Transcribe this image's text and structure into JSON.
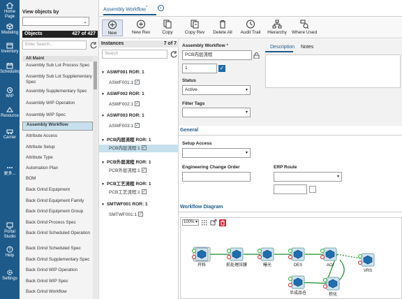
{
  "nav": {
    "items": [
      {
        "label": "Home Page",
        "icon": "home-icon"
      },
      {
        "label": "Modeling",
        "icon": "cube-icon"
      },
      {
        "label": "Inventory",
        "icon": "box-icon"
      },
      {
        "label": "Scheduling",
        "icon": "calendar-icon"
      },
      {
        "label": "WIP",
        "icon": "wip-icon"
      },
      {
        "label": "Resource",
        "icon": "resource-icon"
      },
      {
        "label": "Carrier",
        "icon": "carrier-icon"
      },
      {
        "label": "更多...",
        "icon": "more-icon"
      },
      {
        "label": "Portal Studio",
        "icon": "portal-icon"
      },
      {
        "label": "Help",
        "icon": "help-icon"
      },
      {
        "label": "Settings",
        "icon": "settings-icon"
      }
    ]
  },
  "objects": {
    "view_label": "View objects by",
    "header_label": "Objects",
    "count": "427 of 427",
    "search_placeholder": "Enter Search...",
    "items": [
      {
        "label": "All Maint",
        "kind": "hdr"
      },
      {
        "label": "Assembly Sub Lot Process Spec",
        "kind": "item"
      },
      {
        "label": "Assembly Sub Lot Supplementary Spec",
        "kind": "item"
      },
      {
        "label": "Assembly Supplementary Spec",
        "kind": "item"
      },
      {
        "label": "Assembly WIP Operation",
        "kind": "item"
      },
      {
        "label": "Assembly WIP Spec",
        "kind": "item"
      },
      {
        "label": "Assembly Workflow",
        "kind": "sel"
      },
      {
        "label": "Attribute Access",
        "kind": "item"
      },
      {
        "label": "Attribute Setup",
        "kind": "item"
      },
      {
        "label": "Attribute Type",
        "kind": "item"
      },
      {
        "label": "Automation Plan",
        "kind": "item"
      },
      {
        "label": "BOM",
        "kind": "item"
      },
      {
        "label": "Back Grind Equipment",
        "kind": "item"
      },
      {
        "label": "Back Grind Equipment Family",
        "kind": "item"
      },
      {
        "label": "Back Grind Equipment Group",
        "kind": "item"
      },
      {
        "label": "Back Grind Process Spec",
        "kind": "item"
      },
      {
        "label": "Back Grind Scheduled Operation",
        "kind": "item"
      },
      {
        "label": "Back Grind Scheduled Spec",
        "kind": "item"
      },
      {
        "label": "Back Grind Supplementary Spec",
        "kind": "item"
      },
      {
        "label": "Back Grind WIP Operation",
        "kind": "item"
      },
      {
        "label": "Back Grind WIP Spec",
        "kind": "item"
      },
      {
        "label": "Back Grind Workflow",
        "kind": "item"
      }
    ]
  },
  "tab": {
    "label": "Assembly Workflow",
    "marker": "*"
  },
  "toolbar": {
    "buttons": [
      {
        "label": "New",
        "icon": "plus-circle-icon"
      },
      {
        "label": "New Rev",
        "icon": "plus-circle-icon"
      },
      {
        "label": "Copy",
        "icon": "copy-icon"
      },
      {
        "label": "Copy Rev",
        "icon": "copy-rev-icon"
      },
      {
        "label": "Delete All",
        "icon": "trash-icon"
      },
      {
        "label": "Audit Trail",
        "icon": "clock-icon"
      },
      {
        "label": "Hierarchy",
        "icon": "hierarchy-icon"
      },
      {
        "label": "Where Used",
        "icon": "where-used-icon"
      }
    ]
  },
  "instances": {
    "header_label": "Instances",
    "count": "7 of 7",
    "search_placeholder": "Search",
    "groups": [
      {
        "name": "ASWF001 ROR: 1",
        "revs": [
          {
            "label": "ASWF001:1",
            "sel": false
          }
        ]
      },
      {
        "name": "ASWF002 ROR: 1",
        "revs": [
          {
            "label": "ASWF002:1",
            "sel": false
          }
        ]
      },
      {
        "name": "ASWF003 ROR: 1",
        "revs": [
          {
            "label": "ASWF003:1",
            "sel": false
          }
        ]
      },
      {
        "name": "PCB内层流程 ROR: 1",
        "revs": [
          {
            "label": "PCB内层流程:1",
            "sel": true
          }
        ]
      },
      {
        "name": "PCB外层流程 ROR: 1",
        "revs": [
          {
            "label": "PCB外层流程:1",
            "sel": false
          }
        ]
      },
      {
        "name": "PCB工艺流程 ROR: 1",
        "revs": [
          {
            "label": "PCB工艺流程:1",
            "sel": false
          }
        ]
      },
      {
        "name": "SMTWF001 ROR: 1",
        "revs": [
          {
            "label": "SMTWF001:1",
            "sel": false
          }
        ]
      }
    ]
  },
  "detail": {
    "name_label": "Assembly Workflow",
    "required_mark": "*",
    "name_value": "PCB内层流程",
    "rev_value": "1",
    "status_label": "Status",
    "status_value": "Active",
    "filter_label": "Filter Tags",
    "tabs": {
      "description": "Description",
      "notes": "Notes"
    },
    "general_label": "General",
    "setup_access_label": "Setup Access",
    "eco_label": "Engineering Change Order",
    "erp_label": "ERP Route",
    "diagram_label": "Workflow Diagram",
    "zoom": "100%",
    "nodes": [
      "开料",
      "前处理压膜",
      "曝光",
      "DES",
      "AOI",
      "VRS",
      "半成品仓",
      "棕化"
    ]
  }
}
